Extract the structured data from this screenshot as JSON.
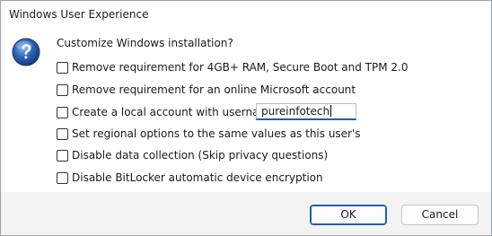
{
  "window": {
    "title": "Windows User Experience"
  },
  "dialog": {
    "icon": "question-icon",
    "heading": "Customize Windows installation?",
    "options": [
      {
        "label": "Remove requirement for 4GB+ RAM, Secure Boot and TPM 2.0",
        "checked": false
      },
      {
        "label": "Remove requirement for an online Microsoft account",
        "checked": false
      },
      {
        "label": "Create a local account with username:",
        "checked": false
      },
      {
        "label": "Set regional options to the same values as this user's",
        "checked": false
      },
      {
        "label": "Disable data collection (Skip privacy questions)",
        "checked": false
      },
      {
        "label": "Disable BitLocker automatic device encryption",
        "checked": false
      }
    ],
    "username_value": "pureinfotech"
  },
  "buttons": {
    "ok_label": "OK",
    "cancel_label": "Cancel"
  },
  "colors": {
    "accent": "#1f5fa8",
    "footer_bg": "#f3f3f3"
  }
}
